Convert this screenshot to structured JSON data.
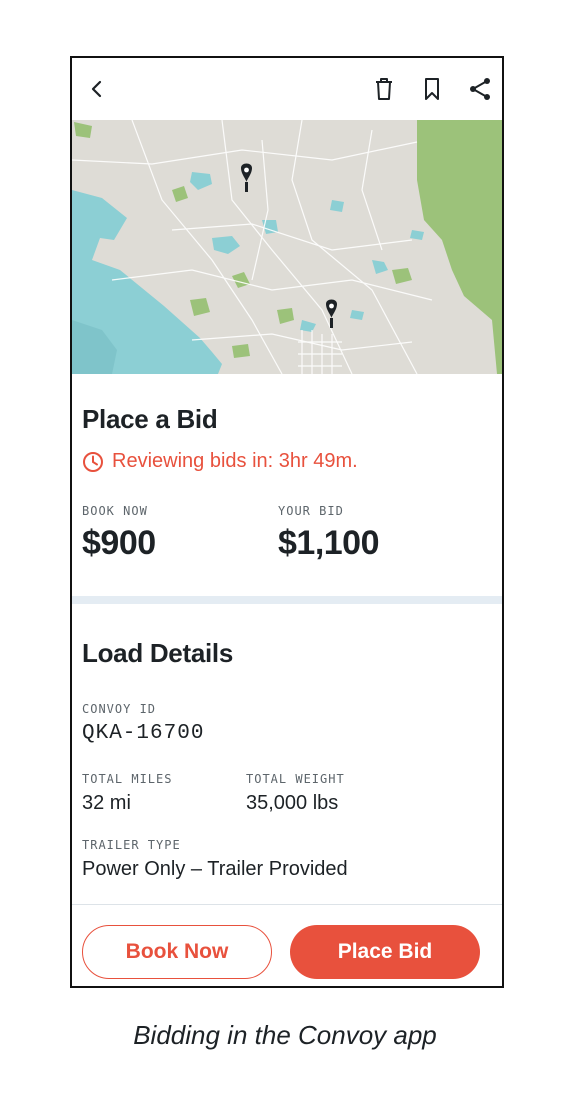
{
  "colors": {
    "accent": "#e8513d",
    "map_water": "#8ccfd4",
    "map_park": "#9cc27a",
    "map_land": "#dedcd6"
  },
  "topbar": {
    "icons": [
      "back-arrow-icon",
      "trash-icon",
      "bookmark-icon",
      "share-icon"
    ]
  },
  "bid": {
    "title": "Place a Bid",
    "timer_text": "Reviewing bids in: 3hr 49m.",
    "book_now_label": "BOOK NOW",
    "book_now_price": "$900",
    "your_bid_label": "YOUR BID",
    "your_bid_price": "$1,100"
  },
  "load": {
    "title": "Load Details",
    "convoy_id_label": "CONVOY ID",
    "convoy_id": "QKA-16700",
    "total_miles_label": "TOTAL MILES",
    "total_miles": "32 mi",
    "total_weight_label": "TOTAL WEIGHT",
    "total_weight": "35,000 lbs",
    "trailer_type_label": "TRAILER TYPE",
    "trailer_type": "Power Only – Trailer Provided"
  },
  "actions": {
    "book_now": "Book Now",
    "place_bid": "Place Bid"
  },
  "caption": "Bidding in the Convoy app"
}
